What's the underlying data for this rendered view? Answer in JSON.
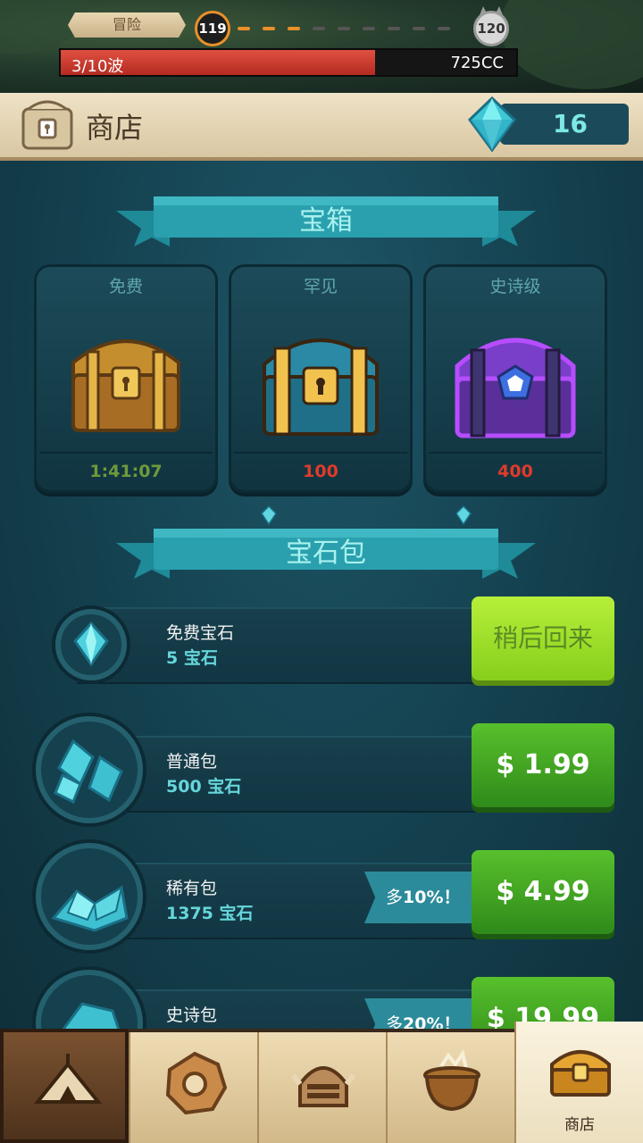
{
  "hud": {
    "mode_label": "冒险",
    "current_level": "119",
    "next_level": "120",
    "wave_text": "3/10波",
    "wave_progress": 0.69,
    "currency_text": "725CC"
  },
  "shop_header": {
    "title": "商店",
    "gem_count": "16"
  },
  "chests_section": {
    "title": "宝箱",
    "chests": [
      {
        "tier": "免费",
        "footer": "1:41:07",
        "footer_color": "#6f9a3a",
        "color": "#c9962f"
      },
      {
        "tier": "罕见",
        "footer": "100",
        "footer_color": "#e03a2a",
        "color": "#2a8aa6"
      },
      {
        "tier": "史诗级",
        "footer": "400",
        "footer_color": "#e03a2a",
        "color": "#8a4bd6"
      }
    ]
  },
  "gems_section": {
    "title": "宝石包",
    "packs": [
      {
        "name": "免费宝石",
        "amount": "5 宝石",
        "button": "稍后回来",
        "bonus": ""
      },
      {
        "name": "普通包",
        "amount": "500 宝石",
        "button": "$ 1.99",
        "bonus": ""
      },
      {
        "name": "稀有包",
        "amount": "1375 宝石",
        "button": "$ 4.99",
        "bonus_prefix": "多",
        "bonus": "10%！"
      },
      {
        "name": "史诗包",
        "amount": "",
        "button": "$ 19.99",
        "bonus_prefix": "多",
        "bonus": "20%！"
      }
    ]
  },
  "nav": {
    "tabs": [
      {
        "name": "home-tab",
        "icon": "tent-icon",
        "label": ""
      },
      {
        "name": "map-tab",
        "icon": "ring-icon",
        "label": ""
      },
      {
        "name": "heroes-tab",
        "icon": "helmet-icon",
        "label": ""
      },
      {
        "name": "alchemy-tab",
        "icon": "cauldron-icon",
        "label": ""
      },
      {
        "name": "shop-tab",
        "icon": "chest-icon",
        "label": "商店"
      }
    ]
  },
  "colors": {
    "accent_gem": "#6fe0e6",
    "buy_green": "#3fa11f",
    "panel_teal": "#14404e"
  }
}
